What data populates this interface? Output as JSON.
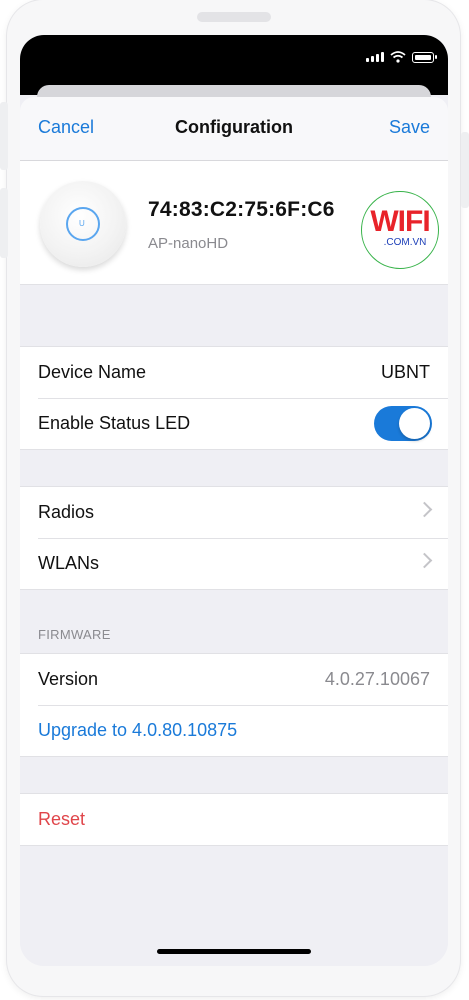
{
  "navbar": {
    "cancel_label": "Cancel",
    "title": "Configuration",
    "save_label": "Save"
  },
  "device": {
    "mac": "74:83:C2:75:6F:C6",
    "model": "AP-nanoHD",
    "ap_mark": "U"
  },
  "watermark": {
    "main": "WIFI",
    "sub": ".COM.VN"
  },
  "settings": {
    "device_name_label": "Device Name",
    "device_name_value": "UBNT",
    "status_led_label": "Enable Status LED",
    "status_led_on": true
  },
  "navigation": {
    "radios_label": "Radios",
    "wlans_label": "WLANs"
  },
  "firmware": {
    "section_title": "FIRMWARE",
    "version_label": "Version",
    "version_value": "4.0.27.10067",
    "upgrade_label": "Upgrade to 4.0.80.10875"
  },
  "actions": {
    "reset_label": "Reset"
  },
  "colors": {
    "accent": "#1a7ad9",
    "danger": "#e0454a",
    "background": "#efeff4"
  }
}
